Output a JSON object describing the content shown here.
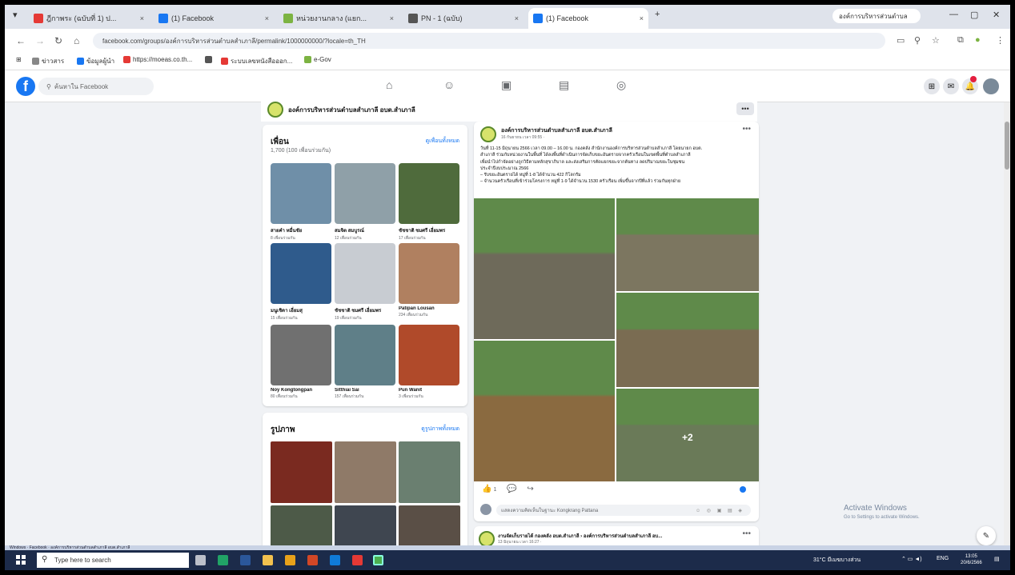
{
  "browser": {
    "tabs": [
      {
        "label": "ฎีกาพระ (ฉบับที่ 1) ป...",
        "color": "#e53935"
      },
      {
        "label": "(1) Facebook",
        "color": "#1877f2"
      },
      {
        "label": "หน่วยงานกลาง (แยก...",
        "color": "#7cb342"
      },
      {
        "label": "PN - 1 (ฉบับ)",
        "color": "#555555"
      },
      {
        "label": "(1) Facebook",
        "color": "#1877f2"
      }
    ],
    "new_tab": "+",
    "profile_label": "องค์การบริหารส่วนตำบล",
    "url": "facebook.com/groups/องค์การบริหารส่วนตำบลสำเภาลี/permalink/1000000000/?locale=th_TH",
    "bookmarks": [
      {
        "label": "ข่าวสาร",
        "color": "#888888"
      },
      {
        "label": "ข้อมูลผู้นำ",
        "color": "#1877f2"
      },
      {
        "label": "https://moeas.co.th...",
        "color": "#e53935"
      },
      {
        "label": "",
        "color": "#555555"
      },
      {
        "label": "ระบบเลขหนังสือออก...",
        "color": "#e53935"
      },
      {
        "label": "e-Gov",
        "color": "#7cb342"
      }
    ]
  },
  "facebook": {
    "search_placeholder": "ค้นหาใน Facebook",
    "group_name": "องค์การบริหารส่วนตำบลสำเภาลี อบต.สำเภาลี",
    "friends": {
      "title": "เพื่อน",
      "count": "1,700 (100 เพื่อนร่วมกัน)",
      "see_all": "ดูเพื่อนทั้งหมด",
      "items": [
        {
          "name": "สายคำ หมื่นชัย",
          "mutual": "8 เพื่อนร่วมกัน",
          "color": "#6f8fa8"
        },
        {
          "name": "สมจิต สมบูรณ์",
          "mutual": "12 เพื่อนร่วมกัน",
          "color": "#8fa0a8"
        },
        {
          "name": "ชัชชาติ ชมศรี เอี่ยมพร",
          "mutual": "17 เพื่อนร่วมกัน",
          "color": "#4f6b3c"
        },
        {
          "name": "มนูเชิดา เอี่ยมสุ",
          "mutual": "15 เพื่อนร่วมกัน",
          "color": "#2f5b8c"
        },
        {
          "name": "ชัชชาติ ชมศรี เอี่ยมพร",
          "mutual": "19 เพื่อนร่วมกัน",
          "color": "#c8ccd2"
        },
        {
          "name": "Patipan Lousan",
          "mutual": "234 เพื่อนร่วมกัน",
          "color": "#b08060"
        },
        {
          "name": "Noy Kongtongpan",
          "mutual": "80 เพื่อนร่วมกัน",
          "color": "#707070"
        },
        {
          "name": "Sitthiai Sai",
          "mutual": "157 เพื่อนร่วมกัน",
          "color": "#5f7f88"
        },
        {
          "name": "Pun Wanit",
          "mutual": "3 เพื่อนร่วมกัน",
          "color": "#b04a2a"
        }
      ]
    },
    "photos": {
      "title": "รูปภาพ",
      "see_all": "ดูรูปภาพทั้งหมด",
      "colors": [
        "#7a2a20",
        "#8f7a68",
        "#6a7f70",
        "#4d5a48",
        "#3f4650",
        "#5a4f46"
      ]
    },
    "post": {
      "author": "องค์การบริหารส่วนตำบลสำเภาลี อบต.สำเภาลี",
      "time": "16 กันยายน เวลา 09:55 ·",
      "text_lines": [
        "วันที่ 11-15 มิถุนายน 2566 เวลา 09.00 – 16.00 น. กองคลัง สำนักงานองค์การบริหารส่วนตำบลสำเภาลี โดยนายก อบต.",
        "สำเภาลี ร่วมกับหน่วยงานในพื้นที่ ได้ลงพื้นที่ดำเนินการจัดเก็บขยะอันตรายจากครัวเรือนในเขตพื้นที่ตำบลสำเภาลี",
        "เพื่อนำไปกำจัดอย่างถูกวิธีตามหลักสุขาภิบาล และส่งเสริมการคัดแยกขยะจากต้นทาง ลดปริมาณขยะในชุมชน",
        "ประจำปีงบประมาณ 2566",
        "– รับขยะอันตรายได้ หมู่ที่ 1-8 ได้จำนวน 422 กิโลกรัม",
        "– จำนวนครัวเรือนที่เข้าร่วมโครงการ หมู่ที่ 1-9 ได้จำนวน 1530 ครัวเรือน เพิ่มขึ้นจากปีที่แล้ว ร่วมกันทุกฝ่าย"
      ],
      "more_photos": "+2",
      "reactions_count": "1",
      "comment_placeholder": "แสดงความคิดเห็นในฐานะ Kongkrang Pattana",
      "image_colors": [
        "#6e6a5a",
        "#7c7660",
        "#7a6c52",
        "#8a6a40",
        "#6a7a58",
        "#7a5a3a"
      ]
    },
    "post2": {
      "author": "งานจัดเก็บรายได้ กองคลัง อบต.สำเภาลี › องค์การบริหารส่วนตำบลสำเภาลี อบ...",
      "time": "13 มิถุนายน เวลา 16:27 ·"
    }
  },
  "windows": {
    "activate_title": "Activate Windows",
    "activate_sub": "Go to Settings to activate Windows.",
    "search_placeholder": "Type here to search",
    "weather": "31°C มีเมฆบางส่วน",
    "lang": "ENG",
    "time": "13:05",
    "date": "20/6/2566",
    "status_bar": "Windows · Facebook · องค์การบริหารส่วนตำบลสำเภาลี อบต.สำเภาลี"
  }
}
